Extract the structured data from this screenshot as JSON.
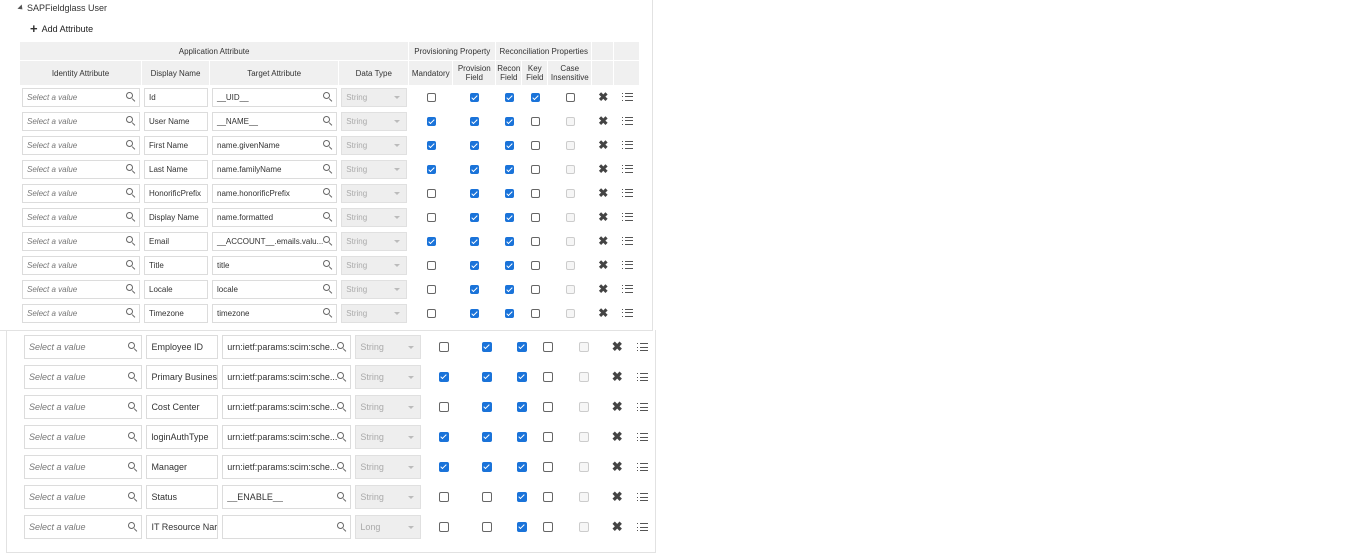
{
  "section": {
    "title": "SAPFieldglass User",
    "add_label": "Add Attribute"
  },
  "headers": {
    "group_application": "Application Attribute",
    "group_provisioning": "Provisioning Property",
    "group_reconciliation": "Reconciliation Properties",
    "identity_attribute": "Identity Attribute",
    "display_name": "Display Name",
    "target_attribute": "Target Attribute",
    "data_type": "Data Type",
    "mandatory": "Mandatory",
    "provision_field_1": "Provision",
    "provision_field_2": "Field",
    "recon_field_1": "Recon",
    "recon_field_2": "Field",
    "key_field_1": "Key",
    "key_field_2": "Field",
    "case_insensitive_1": "Case",
    "case_insensitive_2": "Insensitive"
  },
  "placeholder": "Select a value",
  "rows_top": [
    {
      "display": "Id",
      "target": "__UID__",
      "type": "String",
      "mandatory": false,
      "provision": true,
      "recon": true,
      "key": true,
      "case_enabled": true,
      "case": false
    },
    {
      "display": "User Name",
      "target": "__NAME__",
      "type": "String",
      "mandatory": true,
      "provision": true,
      "recon": true,
      "key": false,
      "case_enabled": false,
      "case": false
    },
    {
      "display": "First Name",
      "target": "name.givenName",
      "type": "String",
      "mandatory": true,
      "provision": true,
      "recon": true,
      "key": false,
      "case_enabled": false,
      "case": false
    },
    {
      "display": "Last Name",
      "target": "name.familyName",
      "type": "String",
      "mandatory": true,
      "provision": true,
      "recon": true,
      "key": false,
      "case_enabled": false,
      "case": false
    },
    {
      "display": "HonorificPrefix",
      "target": "name.honorificPrefix",
      "type": "String",
      "mandatory": false,
      "provision": true,
      "recon": true,
      "key": false,
      "case_enabled": false,
      "case": false
    },
    {
      "display": "Display Name",
      "target": "name.formatted",
      "type": "String",
      "mandatory": false,
      "provision": true,
      "recon": true,
      "key": false,
      "case_enabled": false,
      "case": false
    },
    {
      "display": "Email",
      "target": "__ACCOUNT__.emails.valu...",
      "type": "String",
      "mandatory": true,
      "provision": true,
      "recon": true,
      "key": false,
      "case_enabled": false,
      "case": false
    },
    {
      "display": "Title",
      "target": "title",
      "type": "String",
      "mandatory": false,
      "provision": true,
      "recon": true,
      "key": false,
      "case_enabled": false,
      "case": false
    },
    {
      "display": "Locale",
      "target": "locale",
      "type": "String",
      "mandatory": false,
      "provision": true,
      "recon": true,
      "key": false,
      "case_enabled": false,
      "case": false
    },
    {
      "display": "Timezone",
      "target": "timezone",
      "type": "String",
      "mandatory": false,
      "provision": true,
      "recon": true,
      "key": false,
      "case_enabled": false,
      "case": false
    }
  ],
  "rows_bottom": [
    {
      "display": "Employee ID",
      "target": "urn:ietf:params:scim:sche...",
      "type": "String",
      "mandatory": false,
      "provision": true,
      "recon": true,
      "key": false,
      "case_enabled": false,
      "case": false
    },
    {
      "display": "Primary Busines",
      "target": "urn:ietf:params:scim:sche...",
      "type": "String",
      "mandatory": true,
      "provision": true,
      "recon": true,
      "key": false,
      "case_enabled": false,
      "case": false
    },
    {
      "display": "Cost Center",
      "target": "urn:ietf:params:scim:sche...",
      "type": "String",
      "mandatory": false,
      "provision": true,
      "recon": true,
      "key": false,
      "case_enabled": false,
      "case": false
    },
    {
      "display": "loginAuthType",
      "target": "urn:ietf:params:scim:sche...",
      "type": "String",
      "mandatory": true,
      "provision": true,
      "recon": true,
      "key": false,
      "case_enabled": false,
      "case": false
    },
    {
      "display": "Manager",
      "target": "urn:ietf:params:scim:sche...",
      "type": "String",
      "mandatory": true,
      "provision": true,
      "recon": true,
      "key": false,
      "case_enabled": false,
      "case": false
    },
    {
      "display": "Status",
      "target": "__ENABLE__",
      "type": "String",
      "mandatory": false,
      "provision": false,
      "recon": true,
      "key": false,
      "case_enabled": false,
      "case": false
    },
    {
      "display": "IT Resource Nar",
      "target": "",
      "type": "Long",
      "mandatory": false,
      "provision": false,
      "recon": true,
      "key": false,
      "case_enabled": false,
      "case": false
    }
  ]
}
